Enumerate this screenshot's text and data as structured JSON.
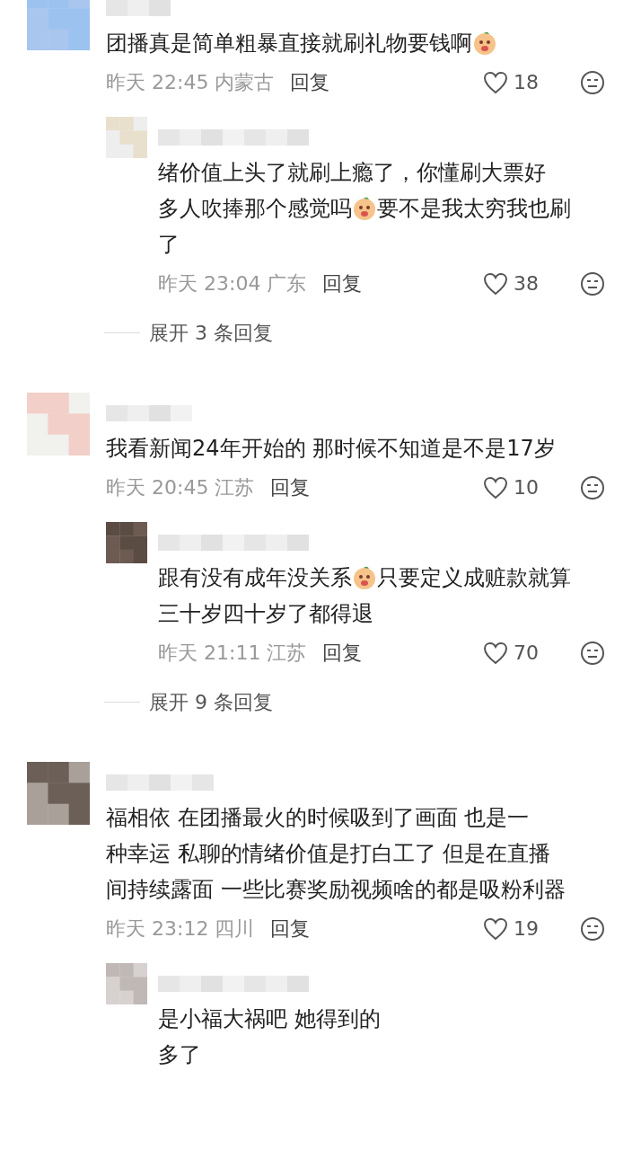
{
  "threads": [
    {
      "comment": {
        "lines": [
          [
            {
              "kind": "text",
              "text": "团播真是简单粗暴直接就刷礼物要钱啊"
            },
            {
              "kind": "emoji"
            }
          ]
        ],
        "meta": "昨天 22:45 内蒙古",
        "reply": "回复",
        "likes": "18"
      },
      "replies": [
        {
          "lines": [
            [
              {
                "kind": "text",
                "text": "绪价值上头了就刷上瘾了，你懂刷大票好"
              }
            ],
            [
              {
                "kind": "text",
                "text": "多人吹捧那个感觉吗"
              },
              {
                "kind": "emoji"
              },
              {
                "kind": "text",
                "text": "要不是我太穷我也刷"
              }
            ],
            [
              {
                "kind": "text",
                "text": "了"
              }
            ]
          ],
          "meta": "昨天 23:04 广东",
          "reply": "回复",
          "likes": "38"
        }
      ],
      "expand": "展开 3 条回复"
    },
    {
      "comment": {
        "lines": [
          [
            {
              "kind": "text",
              "text": "我看新闻24年开始的 那时候不知道是不是17岁"
            }
          ]
        ],
        "meta": "昨天 20:45 江苏",
        "reply": "回复",
        "likes": "10"
      },
      "replies": [
        {
          "lines": [
            [
              {
                "kind": "text",
                "text": "跟有没有成年没关系"
              },
              {
                "kind": "emoji"
              },
              {
                "kind": "text",
                "text": "只要定义成赃款就算"
              }
            ],
            [
              {
                "kind": "text",
                "text": "三十岁四十岁了都得退"
              }
            ]
          ],
          "meta": "昨天 21:11 江苏",
          "reply": "回复",
          "likes": "70"
        }
      ],
      "expand": "展开 9 条回复"
    },
    {
      "comment": {
        "lines": [
          [
            {
              "kind": "text",
              "text": "福相依 在团播最火的时候吸到了画面 也是一"
            }
          ],
          [
            {
              "kind": "text",
              "text": "种幸运 私聊的情绪价值是打白工了 但是在直播"
            }
          ],
          [
            {
              "kind": "text",
              "text": "间持续露面 一些比赛奖励视频啥的都是吸粉利器"
            }
          ]
        ],
        "meta": "昨天 23:12 四川",
        "reply": "回复",
        "likes": "19"
      },
      "replies": [
        {
          "lines": [
            [
              {
                "kind": "text",
                "text": "是小福大祸吧 她得到的"
              }
            ],
            [
              {
                "kind": "text",
                "text": "多了"
              }
            ]
          ]
        }
      ]
    }
  ]
}
